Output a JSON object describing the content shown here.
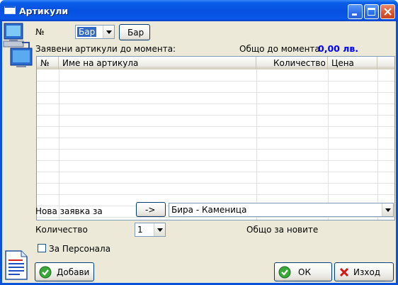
{
  "window": {
    "title": "Артикули"
  },
  "form": {
    "number_label": "№",
    "number_combo_value": "Бар",
    "number_button_label": "Бар",
    "ordered_label": "Заявени артикули до момента:",
    "total_label": "Общо до момента",
    "total_value": "0,00 лв.",
    "total_value_color": "#0000ff"
  },
  "table": {
    "columns": [
      "№",
      "Име на артикула",
      "Количество",
      "Цена"
    ],
    "rows": []
  },
  "new_order": {
    "label": "Нова заявка за",
    "arrow_button_label": "->",
    "article_value": "Бира - Каменица",
    "quantity_label": "Количество",
    "quantity_value": "1",
    "new_total_label": "Общо за новите",
    "staff_checkbox_label": "За Персонала",
    "staff_checked": false
  },
  "buttons": {
    "add_label": "Добави",
    "ok_label": "ОК",
    "exit_label": "Изход"
  },
  "icons": {
    "add": "green-check-icon",
    "ok": "green-check-icon",
    "exit": "red-x-icon",
    "side_top": "computers-network-icon",
    "side_bottom": "document-icon"
  }
}
